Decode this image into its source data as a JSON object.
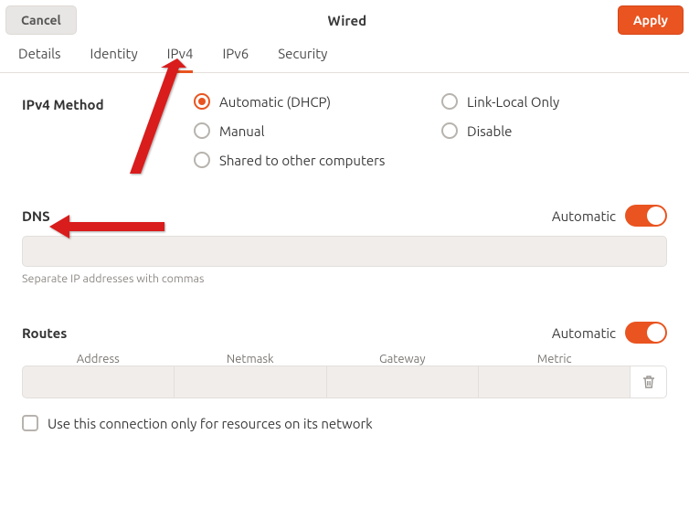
{
  "header": {
    "cancel": "Cancel",
    "title": "Wired",
    "apply": "Apply"
  },
  "tabs": [
    "Details",
    "Identity",
    "IPv4",
    "IPv6",
    "Security"
  ],
  "active_tab": "IPv4",
  "ipv4": {
    "method_label": "IPv4 Method",
    "options": {
      "automatic": "Automatic (DHCP)",
      "link_local": "Link-Local Only",
      "manual": "Manual",
      "disable": "Disable",
      "shared": "Shared to other computers"
    },
    "selected": "automatic"
  },
  "dns": {
    "title": "DNS",
    "automatic_label": "Automatic",
    "automatic_on": true,
    "value": "",
    "helper": "Separate IP addresses with commas"
  },
  "routes": {
    "title": "Routes",
    "automatic_label": "Automatic",
    "automatic_on": true,
    "columns": [
      "Address",
      "Netmask",
      "Gateway",
      "Metric"
    ],
    "rows": [
      {
        "address": "",
        "netmask": "",
        "gateway": "",
        "metric": ""
      }
    ],
    "checkbox_label": "Use this connection only for resources on its network",
    "checkbox_checked": false
  },
  "icons": {
    "trash": "trash-icon"
  }
}
